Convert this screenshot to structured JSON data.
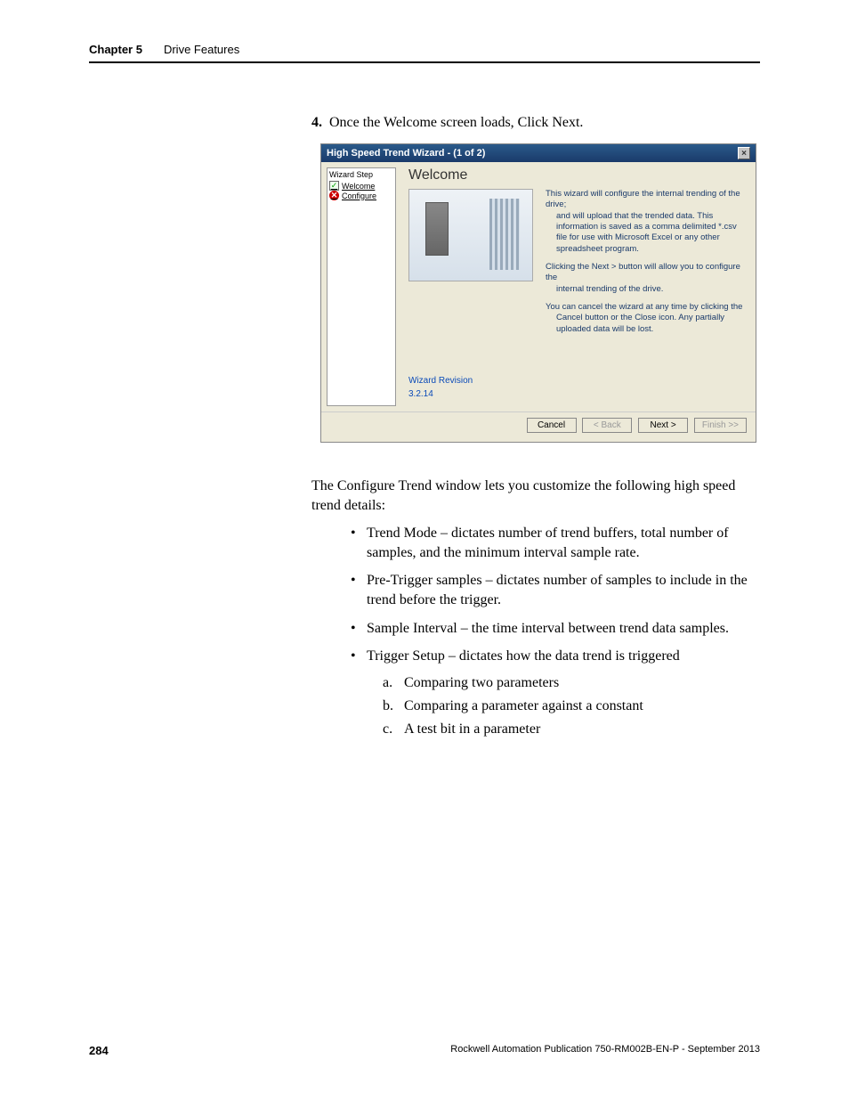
{
  "header": {
    "chapter_num": "Chapter 5",
    "chapter_title": "Drive Features"
  },
  "step4": {
    "number": "4.",
    "text": "Once the Welcome screen loads, Click Next."
  },
  "wizard": {
    "title": "High Speed Trend Wizard - (1 of 2)",
    "close_glyph": "×",
    "sidebar_title": "Wizard Step",
    "step_welcome": "Welcome",
    "step_configure": "Configure",
    "heading": "Welcome",
    "p1_lead": "This wizard will configure the internal trending of the drive;",
    "p1_rest": "and will upload that the trended data. This information is saved as a comma delimited *.csv file for use with Microsoft Excel or any other spreadsheet program.",
    "p2_lead": "Clicking the Next > button will allow you to configure the",
    "p2_rest": "internal trending of the drive.",
    "p3_lead": "You can cancel the wizard at any time by clicking the",
    "p3_rest": "Cancel button or the Close icon. Any partially uploaded data will be lost.",
    "rev_label": "Wizard Revision",
    "rev_value": "3.2.14",
    "btn_cancel": "Cancel",
    "btn_back": "< Back",
    "btn_next": "Next >",
    "btn_finish": "Finish >>"
  },
  "paragraph": "The Configure Trend window lets you customize the following high speed trend details:",
  "bullets": [
    "Trend Mode – dictates number of trend buffers, total number of samples, and the minimum interval sample rate.",
    "Pre-Trigger samples – dictates number of samples to include in the trend before the trigger.",
    "Sample Interval – the time interval between trend data samples.",
    "Trigger Setup – dictates how the data trend is triggered"
  ],
  "sublist": [
    {
      "letter": "a.",
      "text": "Comparing two parameters"
    },
    {
      "letter": "b.",
      "text": "Comparing a parameter against a constant"
    },
    {
      "letter": "c.",
      "text": "A test bit in a parameter"
    }
  ],
  "footer": {
    "page": "284",
    "pub": "Rockwell Automation Publication 750-RM002B-EN-P - September 2013"
  }
}
